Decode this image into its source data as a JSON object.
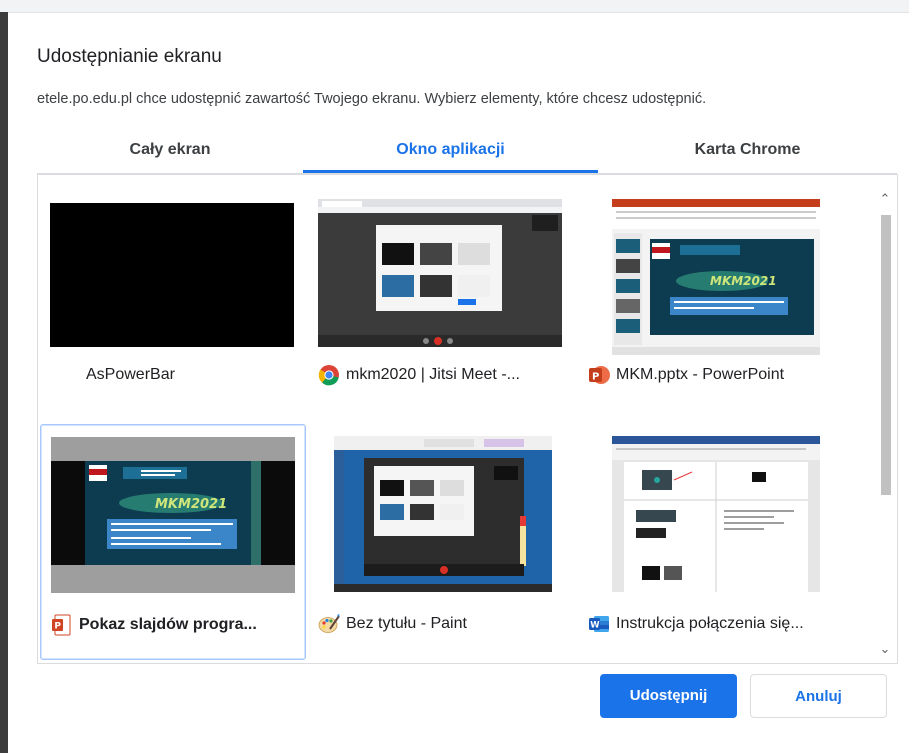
{
  "dialog": {
    "title": "Udostępnianie ekranu",
    "subtitle": "etele.po.edu.pl chce udostępnić zawartość Twojego ekranu. Wybierz elementy, które chcesz udostępnić."
  },
  "tabs": [
    {
      "label": "Cały ekran",
      "active": false
    },
    {
      "label": "Okno aplikacji",
      "active": true
    },
    {
      "label": "Karta Chrome",
      "active": false
    }
  ],
  "windows": [
    {
      "label": "AsPowerBar",
      "icon": "none"
    },
    {
      "label": "mkm2020 | Jitsi Meet -...",
      "icon": "chrome-icon"
    },
    {
      "label": "MKM.pptx - PowerPoint",
      "icon": "powerpoint-icon"
    },
    {
      "label": "Pokaz slajdów progra...",
      "icon": "powerpoint-slideshow-icon",
      "selected": true
    },
    {
      "label": "Bez tytułu - Paint",
      "icon": "paint-icon"
    },
    {
      "label": "Instrukcja połączenia się...",
      "icon": "word-icon"
    }
  ],
  "thumb_texts": {
    "mkm": "MKM2021"
  },
  "buttons": {
    "share": "Udostępnij",
    "cancel": "Anuluj"
  },
  "colors": {
    "accent": "#1a73e8",
    "selected_border": "#a8c7fa"
  }
}
